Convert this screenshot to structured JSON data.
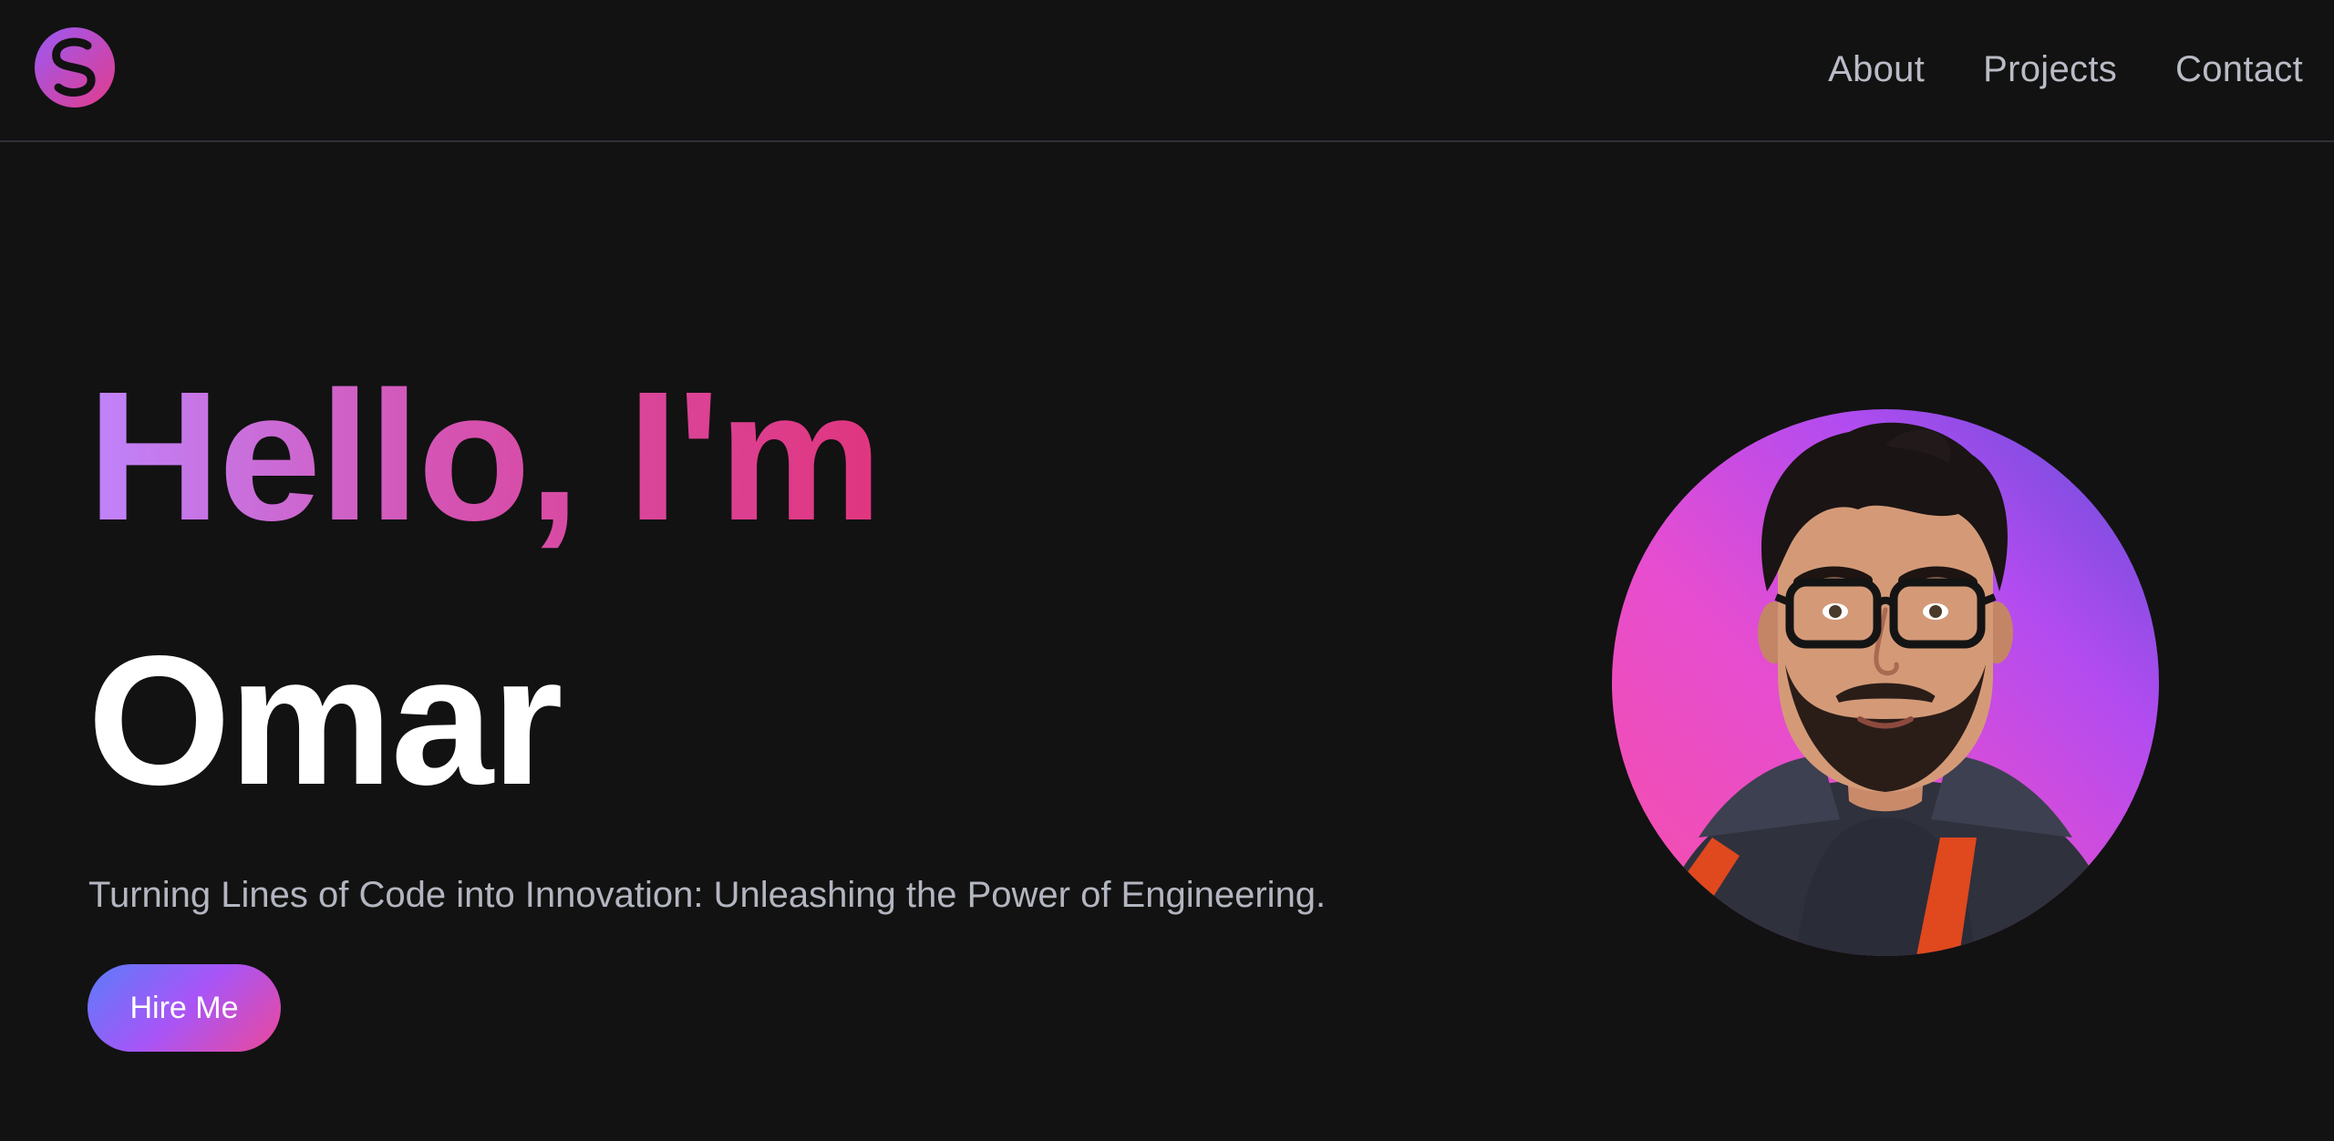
{
  "header": {
    "logo_icon": "s-logo-icon",
    "nav": [
      {
        "label": "About"
      },
      {
        "label": "Projects"
      },
      {
        "label": "Contact"
      }
    ]
  },
  "hero": {
    "greeting": "Hello, I'm",
    "name": "Omar",
    "tagline": "Turning Lines of Code into Innovation: Unleashing the Power of Engineering.",
    "cta_label": "Hire Me",
    "avatar_icon": "profile-avatar"
  },
  "colors": {
    "background": "#121212",
    "greeting_gradient": [
      "#c084fc",
      "#e0357e"
    ],
    "button_gradient": [
      "#5b7cfa",
      "#ec4899"
    ],
    "nav_text": "#b9bcc6",
    "tagline_text": "#b3b6c0"
  }
}
